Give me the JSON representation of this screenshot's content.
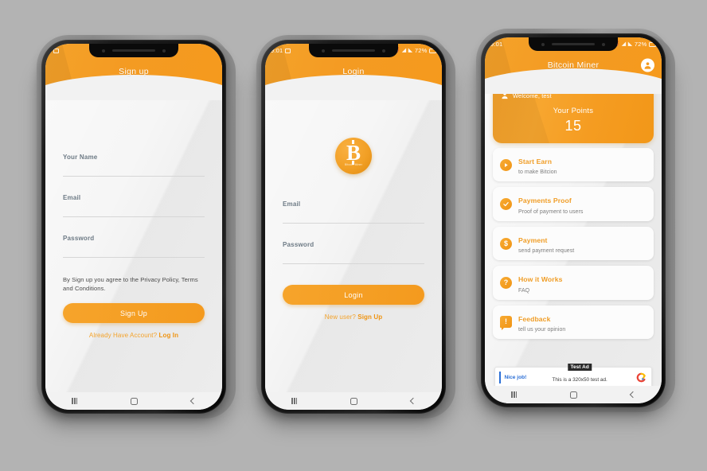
{
  "background_color": "#b3b3b3",
  "accent_color": "#f5a02a",
  "phones": [
    {
      "id": "signup",
      "status_bar": {
        "time": "",
        "battery": "",
        "icons": [
          "image-icon"
        ]
      },
      "header": {
        "title": "Sign up",
        "has_avatar": false
      },
      "form": {
        "fields": [
          {
            "label": "Your Name",
            "value": "",
            "placeholder": ""
          },
          {
            "label": "Email",
            "value": "",
            "placeholder": ""
          },
          {
            "label": "Password",
            "value": "",
            "placeholder": ""
          }
        ],
        "terms": "By Sign up you agree to the Privacy Policy, Terms and Conditions.",
        "submit_label": "Sign Up",
        "switch_prefix": "Already Have Account? ",
        "switch_link": "Log In"
      },
      "nav": {
        "recent": "recent-apps",
        "home": "home",
        "back": "back"
      }
    },
    {
      "id": "login",
      "status_bar": {
        "time": "9:01",
        "battery": "72%",
        "icons": [
          "image-icon",
          "alarm-icon",
          "wifi-icon",
          "signal-icon",
          "battery-icon"
        ]
      },
      "header": {
        "title": "Login",
        "has_avatar": false
      },
      "logo": {
        "symbol": "B",
        "caption": "Bitcoin Miner"
      },
      "form": {
        "fields": [
          {
            "label": "Email",
            "value": "",
            "placeholder": ""
          },
          {
            "label": "Password",
            "value": "",
            "placeholder": ""
          }
        ],
        "submit_label": "Login",
        "switch_prefix": "New user? ",
        "switch_link": "Sign Up"
      },
      "nav": {
        "recent": "recent-apps",
        "home": "home",
        "back": "back"
      }
    },
    {
      "id": "home",
      "status_bar": {
        "time": "9:01",
        "battery": "72%",
        "icons": [
          "alarm-icon",
          "wifi-icon",
          "signal-icon",
          "battery-icon"
        ]
      },
      "header": {
        "title": "Bitcoin Miner",
        "has_avatar": true
      },
      "points_card": {
        "welcome": "Welcome, test",
        "points_label": "Your Points",
        "points_value": "15"
      },
      "menu": [
        {
          "icon": "play-icon",
          "title": "Start Earn",
          "subtitle": "to make Bitcion"
        },
        {
          "icon": "check-icon",
          "title": "Payments Proof",
          "subtitle": "Proof of payment to users"
        },
        {
          "icon": "dollar-icon",
          "title": "Payment",
          "subtitle": "send payment request"
        },
        {
          "icon": "question-icon",
          "title": "How it Works",
          "subtitle": "FAQ"
        },
        {
          "icon": "feedback-icon",
          "title": "Feedback",
          "subtitle": "tell us your opinion"
        }
      ],
      "ad": {
        "headline": "Nice job!",
        "badge": "Test Ad",
        "body": "This is a 320x50 test ad.",
        "network_icon": "admob-icon"
      },
      "nav": {
        "recent": "recent-apps",
        "home": "home",
        "back": "back"
      }
    }
  ]
}
